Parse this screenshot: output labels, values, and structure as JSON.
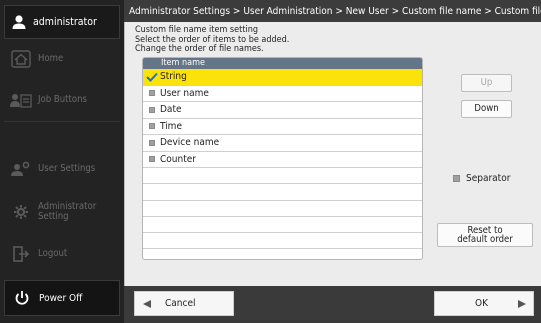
{
  "sidebar": {
    "user": {
      "name": "administrator",
      "icon": "person-icon"
    },
    "items": [
      {
        "label": "Home",
        "icon": "home-icon"
      },
      {
        "label": "Job Buttons",
        "icon": "job-buttons-icon"
      },
      {
        "label": "User Settings",
        "icon": "user-settings-icon"
      },
      {
        "label": "Administrator Setting",
        "icon": "wrench-icon"
      },
      {
        "label": "Logout",
        "icon": "logout-icon"
      }
    ],
    "power": {
      "label": "Power Off",
      "icon": "power-icon"
    }
  },
  "header": {
    "breadcrumb": "Administrator Settings > User Administration > New User > Custom file name > Custom file name item s⋯"
  },
  "main": {
    "description": [
      "Custom file name item setting",
      "Select the order of items to be added.",
      "Change the order of file names."
    ],
    "list": {
      "header": "Item name",
      "rows": [
        {
          "label": "String",
          "selected": true
        },
        {
          "label": "User name",
          "selected": false
        },
        {
          "label": "Date",
          "selected": false
        },
        {
          "label": "Time",
          "selected": false
        },
        {
          "label": "Device name",
          "selected": false
        },
        {
          "label": "Counter",
          "selected": false
        }
      ],
      "empty_rows": 6
    },
    "buttons": {
      "up": "Up",
      "down": "Down",
      "reset_line1": "Reset to",
      "reset_line2": "default order"
    },
    "separator_label": "Separator"
  },
  "footer": {
    "cancel": "Cancel",
    "ok": "OK"
  },
  "colors": {
    "selected_row": "#fbe20a",
    "list_header": "#637587",
    "checkmark": "#1e6fd0"
  }
}
